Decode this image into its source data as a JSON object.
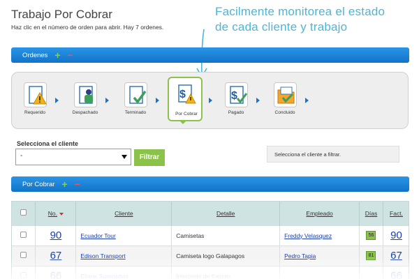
{
  "page": {
    "title": "Trabajo Por Cobrar",
    "subtitle": "Haz clic en el número de orden para abrir. Hay 7 ordenes."
  },
  "promo": {
    "line1": "Facilmente monitorea el  estado",
    "line2": "de cada cliente y trabajo",
    "color": "#4db6d6"
  },
  "orders_bar": {
    "label": "Ordenes",
    "add": "+",
    "remove": "−"
  },
  "workflow": {
    "steps": [
      {
        "label": "Requerido",
        "icon": "warning-document-icon"
      },
      {
        "label": "Despachado",
        "icon": "dispatched-document-icon"
      },
      {
        "label": "Terminado",
        "icon": "check-document-icon"
      },
      {
        "label": "Por Cobrar",
        "icon": "money-warning-document-icon"
      },
      {
        "label": "Pagado",
        "icon": "money-check-document-icon"
      },
      {
        "label": "Concluido",
        "icon": "folder-check-icon"
      }
    ],
    "active_index": 3,
    "accent": "#8bc34a"
  },
  "filter": {
    "label": "Selecciona el cliente",
    "selected": "-",
    "button": "Filtrar",
    "hint": "Selecciona el cliente a filtrar."
  },
  "por_cobrar_bar": {
    "label": "Por Cobrar",
    "add": "+",
    "remove": "−"
  },
  "table": {
    "headers": [
      "No.",
      "Cliente",
      "Detalle",
      "Empleado",
      "Días",
      "Fact."
    ],
    "rows": [
      {
        "no": "90",
        "cliente": "Ecuador Tour",
        "detalle": "Camisetas",
        "empleado": "Freddy Velasquez",
        "dias": "56",
        "fact": "90"
      },
      {
        "no": "67",
        "cliente": "Edison Transport",
        "detalle": "Camiseta logo Galapagos",
        "empleado": "Pedro Tapia",
        "dias": "81",
        "fact": "67"
      },
      {
        "no": "66",
        "cliente": "Eliana Suasnabas",
        "detalle": "Interprete de frances",
        "empleado": "",
        "dias": "",
        "fact": "66"
      }
    ]
  }
}
